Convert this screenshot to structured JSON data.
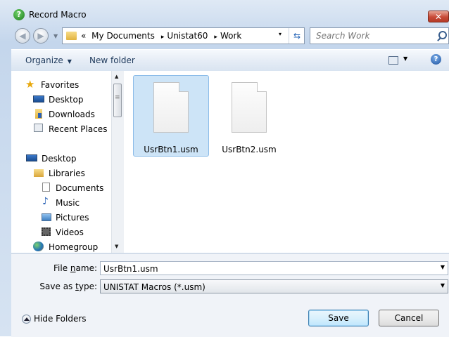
{
  "window": {
    "title": "Record Macro",
    "close_symbol": "✕"
  },
  "address_bar": {
    "overflow": "«",
    "crumbs": [
      "My Documents",
      "Unistat60",
      "Work"
    ],
    "separator": "▸",
    "dropdown": "▾",
    "refresh_icon": "refresh-icon"
  },
  "search": {
    "placeholder": "Search Work"
  },
  "toolbar": {
    "organize_label": "Organize",
    "new_folder_label": "New folder",
    "help_label": "?"
  },
  "nav": {
    "favorites": {
      "label": "Favorites",
      "items": [
        "Desktop",
        "Downloads",
        "Recent Places"
      ]
    },
    "desktop": "Desktop",
    "libraries": {
      "label": "Libraries",
      "items": [
        "Documents",
        "Music",
        "Pictures",
        "Videos"
      ]
    },
    "homegroup": "Homegroup"
  },
  "files": [
    {
      "name": "UsrBtn1.usm",
      "selected": true
    },
    {
      "name": "UsrBtn2.usm",
      "selected": false
    }
  ],
  "form": {
    "file_name_label_pre": "File ",
    "file_name_label_ul": "n",
    "file_name_label_post": "ame:",
    "file_name_value": "UsrBtn1.usm",
    "save_type_label_pre": "Save as ",
    "save_type_label_ul": "t",
    "save_type_label_post": "ype:",
    "save_type_value": "UNISTAT Macros (*.usm)"
  },
  "buttons": {
    "hide_folders": "Hide Folders",
    "save": "Save",
    "cancel": "Cancel"
  },
  "colors": {
    "selection": "#cde4f7",
    "close": "#c84a37",
    "accent": "#3c7fb1"
  }
}
